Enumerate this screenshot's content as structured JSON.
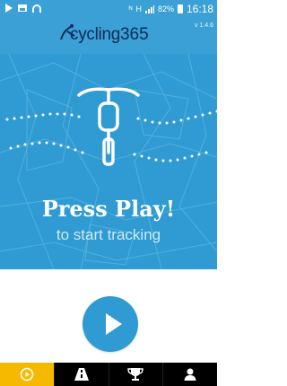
{
  "status_bar": {
    "time": "16:18",
    "battery": "82%",
    "network_text": "H"
  },
  "header": {
    "logo_word": "cycling",
    "logo_number": "365",
    "version": "v 1.4.6"
  },
  "hero": {
    "title": "Press Play!",
    "subtitle": "to start tracking"
  },
  "nav": {
    "items": [
      {
        "name": "play",
        "icon": "play-circle-icon",
        "active": true
      },
      {
        "name": "road",
        "icon": "road-icon",
        "active": false
      },
      {
        "name": "trophy",
        "icon": "trophy-icon",
        "active": false
      },
      {
        "name": "profile",
        "icon": "user-icon",
        "active": false
      }
    ]
  },
  "colors": {
    "primary": "#3aa0d5",
    "hero_bg": "#2f9bd2",
    "logo_text": "#0e2a5a",
    "nav_active": "#f7b900",
    "nav_bg": "#000000"
  }
}
